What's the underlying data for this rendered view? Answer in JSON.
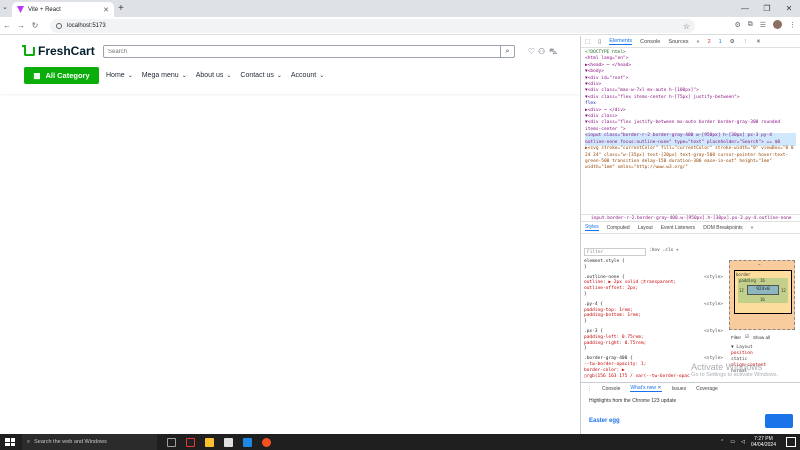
{
  "browser": {
    "tab_title": "Vite + React",
    "tab_close": "✕",
    "new_tab": "+",
    "tab_search": "⌄",
    "url": "localhost:5173",
    "nav": {
      "back": "←",
      "forward": "→",
      "reload": "↻"
    },
    "star": "☆",
    "window_controls": {
      "minimize": "—",
      "restore": "❐",
      "close": "✕"
    }
  },
  "site": {
    "logo_text": "FreshCart",
    "search_placeholder": "Search",
    "search_icon": "⌕",
    "icons": {
      "wishlist": "♡",
      "user": "⚇",
      "cart": "⛍"
    },
    "all_category_label": "All Category",
    "menu": [
      {
        "label": "Home",
        "chevron": "⌄"
      },
      {
        "label": "Mega menu",
        "chevron": "⌄"
      },
      {
        "label": "About us",
        "chevron": "⌄"
      },
      {
        "label": "Contact us",
        "chevron": "⌄"
      },
      {
        "label": "Account",
        "chevron": "⌄"
      }
    ],
    "brand_color": "#0aad0a"
  },
  "devtools": {
    "tabs": [
      "Elements",
      "Console",
      "Sources",
      "»"
    ],
    "active_tab": "Elements",
    "error_count": "2",
    "warn_count": "1",
    "elements_lines": [
      "<!DOCTYPE html>",
      "<html lang=\"en\">",
      "▶<head> ⋯ </head>",
      "▼<body>",
      "  ▼<div id=\"root\">",
      "    ▼<div>",
      "      ▼<div class=\"max-w-7xl mx-auto h-[100px]\">",
      "        ▼<div class=\"flex items-center h-[75px] justify-between\">",
      "            flex",
      "          ▶<div> ⋯ </div>",
      "          ▼<div class>",
      "            ▼<div class=\"flex  justify-between mx-auto border border-gray-300 rounded items-center \">",
      "                <input class=\"border-r-2 border-gray-400 w-[950px] h-[30px] px-3 py-4 outline-none focus:outline-none\" type=\"text\" placeholder=\"Search\"> == $0",
      "              ▶<svg stroke=\"currentColor\" fill=\"currentColor\" stroke-width=\"0\" viewBox=\"0 0 24 24\" class=\"w-[35px] text-[20px] text-gray-500 cursor-pointer hover:text-green-500 transition delay-150 duration-300 ease-in-out\" height=\"1em\" width=\"1em\" xmlns=\"http://www.w3.org/\""
    ],
    "breadcrumb": "input.border-r-2.border-gray-400.w-[950px].h-[30px].px-3.py-4.outline-none",
    "style_tabs": [
      "Styles",
      "Computed",
      "Layout",
      "Event Listeners",
      "DOM Breakpoints",
      "»"
    ],
    "filter_placeholder": "Filter",
    "filter_tools": ":hov  .cls  +",
    "rules": [
      {
        "selector": "element.style {",
        "source": "",
        "props": [
          "}"
        ]
      },
      {
        "selector": ".outline-none {",
        "source": "<style>",
        "props": [
          "outline: ▶ 2px solid ▢transparent;",
          "outline-offset: 2px;",
          "}"
        ]
      },
      {
        "selector": ".py-4 {",
        "source": "<style>",
        "props": [
          "padding-top: 1rem;",
          "padding-bottom: 1rem;",
          "}"
        ]
      },
      {
        "selector": ".px-3 {",
        "source": "<style>",
        "props": [
          "padding-left: 0.75rem;",
          "padding-right: 0.75rem;",
          "}"
        ]
      },
      {
        "selector": ".border-gray-400 {",
        "source": "<style>",
        "props": [
          "--tw-border-opacity: 1;",
          "border-color: ▶",
          "  ▢rgb(156 163 175 / var(--tw-border-opac"
        ]
      }
    ],
    "box_model": {
      "margin_label": "–",
      "border_label": "border",
      "padding_label": "padding",
      "padding_value": "16",
      "side_value": "12",
      "content": "924×0"
    },
    "show_all_label": "Show all",
    "filter2": "Filter",
    "layout_section": [
      "▼ Layout",
      "position",
      "static",
      "align-content",
      "normal"
    ],
    "drawer_tabs": [
      "Console",
      "What's new ✕",
      "Issues",
      "Coverage"
    ],
    "drawer_active": "What's new ✕",
    "drawer_headline": "Highlights from the Chrome 123 update",
    "easter_egg": "Easter egg"
  },
  "watermark": {
    "line1": "Activate Windows",
    "line2": "Go to Settings to activate Windows."
  },
  "taskbar": {
    "search_placeholder": "Search the web and Windows",
    "time": "7:27 PM",
    "date": "04/04/2024",
    "app_colors": [
      "#9e9e9e",
      "#e53935",
      "#fbc02d",
      "#e0e0e0",
      "#1e88e5",
      "#f4511e"
    ]
  }
}
